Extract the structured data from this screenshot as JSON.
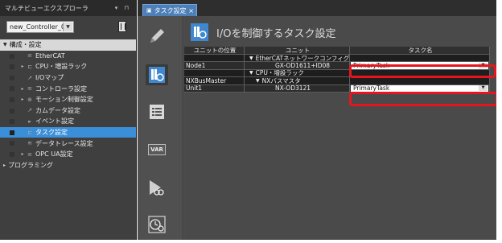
{
  "explorer": {
    "title": "マルチビューエクスプローラ",
    "header_icons": "▾ ⊓",
    "controller": "new_Controller_0",
    "tree": [
      {
        "label": "構成・設定",
        "kind": "section",
        "arrow": "▼"
      },
      {
        "label": "EtherCAT",
        "kind": "item",
        "exp": "",
        "icon": "≡"
      },
      {
        "label": "CPU・増設ラック",
        "kind": "item",
        "exp": "▸",
        "icon": "⊏"
      },
      {
        "label": "I/Oマップ",
        "kind": "item",
        "exp": "",
        "icon": "↗"
      },
      {
        "label": "コントローラ設定",
        "kind": "item",
        "exp": "▸",
        "icon": "≡"
      },
      {
        "label": "モーション制御設定",
        "kind": "item",
        "exp": "▸",
        "icon": "⊕"
      },
      {
        "label": "カムデータ設定",
        "kind": "item",
        "exp": "",
        "icon": "↗"
      },
      {
        "label": "イベント設定",
        "kind": "item",
        "exp": "",
        "icon": "▸"
      },
      {
        "label": "タスク設定",
        "kind": "item",
        "exp": "",
        "icon": "⊏",
        "selected": true
      },
      {
        "label": "データトレース設定",
        "kind": "item",
        "exp": "",
        "icon": "≋"
      },
      {
        "label": "OPC UA設定",
        "kind": "item",
        "exp": "▸",
        "icon": "≡"
      },
      {
        "label": "プログラミング",
        "kind": "section2",
        "arrow": "▸"
      }
    ]
  },
  "editor": {
    "tab_label": "タスク設定",
    "tab_close": "×",
    "tools": [
      "edit-pencil-icon",
      "task-io-icon",
      "list-icon",
      "var-icon",
      "program-icon",
      "timer-icon"
    ],
    "var_label": "VAR",
    "page_title": "I/Oを制御するタスク設定",
    "grid": {
      "headers": [
        "ユニットの位置",
        "ユニット",
        "タスク名"
      ],
      "rows": [
        {
          "type": "group",
          "c1": "",
          "c2": "EtherCATネットワークコンフィグレー",
          "c3": ""
        },
        {
          "type": "data",
          "c1": "Node1",
          "c2": "GX-OD1611+ID08",
          "c3": "PrimaryTask"
        },
        {
          "type": "group",
          "c1": "",
          "c2": "CPU・増設ラック",
          "c3": ""
        },
        {
          "type": "group",
          "c1": "NXBusMaster",
          "c2": "NXバスマスタ",
          "c3": ""
        },
        {
          "type": "data",
          "c1": "Unit1",
          "c2": "NX-OD3121",
          "c3": "PrimaryTask"
        }
      ]
    }
  },
  "colors": {
    "highlight": "#e8141e",
    "selection": "#3b8fd8",
    "tab": "#4d7fb8"
  }
}
